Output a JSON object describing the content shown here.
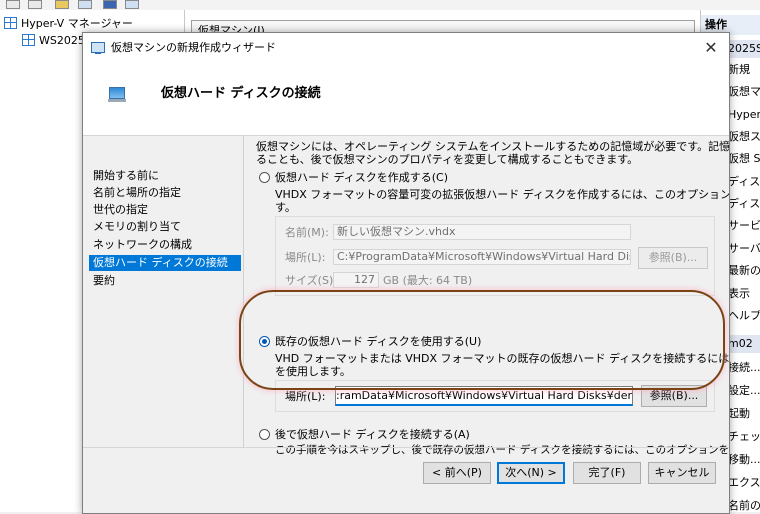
{
  "hyperv": {
    "tree_root": "Hyper-V マネージャー",
    "tree_server": "WS2025",
    "center_header": "仮想マシン(I)",
    "actions_title": "操作",
    "actions_server": "2025SV0",
    "actions_items": [
      "新規",
      "仮想マ",
      "Hyper-",
      "仮想ス",
      "仮想 SA",
      "ディスク",
      "ディスク",
      "サービス",
      "サーバー",
      "最新の",
      "表示",
      "ヘルプ"
    ],
    "actions_vm_group": "m02",
    "actions_vm_items": [
      "接続...",
      "設定...",
      "起動",
      "チェック",
      "移動...",
      "エクスポ",
      "名前の"
    ]
  },
  "wizard": {
    "title": "仮想マシンの新規作成ウィザード",
    "close_glyph": "✕",
    "heading": "仮想ハード ディスクの接続",
    "nav": [
      {
        "label": "開始する前に"
      },
      {
        "label": "名前と場所の指定"
      },
      {
        "label": "世代の指定"
      },
      {
        "label": "メモリの割り当て"
      },
      {
        "label": "ネットワークの構成"
      },
      {
        "label": "仮想ハード ディスクの接続",
        "active": true
      },
      {
        "label": "要約"
      }
    ],
    "intro_line1": "仮想マシンには、オペレーティング システムをインストールするための記憶域が必要です。記憶域を今指定す",
    "intro_line2": "ることも、後で仮想マシンのプロパティを変更して構成することもできます。",
    "option_create": {
      "label": "仮想ハード ディスクを作成する(C)",
      "desc_line1": "VHDX フォーマットの容量可変の拡張仮想ハード ディスクを作成するには、このオプションを使用しま",
      "desc_line2": "す。",
      "name_label": "名前(M):",
      "name_value": "新しい仮想マシン.vhdx",
      "location_label": "場所(L):",
      "location_value": "C:¥ProgramData¥Microsoft¥Windows¥Virtual Hard Disks¥",
      "browse_label": "参照(B)...",
      "size_label": "サイズ(S):",
      "size_value": "127",
      "size_unit": "GB (最大: 64 TB)"
    },
    "option_existing": {
      "label": "既存の仮想ハード ディスクを使用する(U)",
      "selected": true,
      "desc_line1": "VHD フォーマットまたは VHDX フォーマットの既存の仮想ハード ディスクを接続するには、このオプション",
      "desc_line2": "を使用します。",
      "location_label": "場所(L):",
      "location_value_prefix": ":ramData¥Microsoft¥Windows¥Virtual Hard Disks¥demovhd.",
      "location_value_selected": "vhd",
      "browse_label": "参照(B)..."
    },
    "option_later": {
      "label": "後で仮想ハード ディスクを接続する(A)",
      "desc_line1": "この手順を今はスキップし、後で既存の仮想ハード ディスクを接続するには、このオプションを使用しま",
      "desc_line2": "す。"
    },
    "buttons": {
      "back": "< 前へ(P)",
      "next": "次へ(N) >",
      "finish": "完了(F)",
      "cancel": "キャンセル"
    }
  },
  "colors": {
    "accent": "#0078d7",
    "annotation": "#7a4414"
  }
}
